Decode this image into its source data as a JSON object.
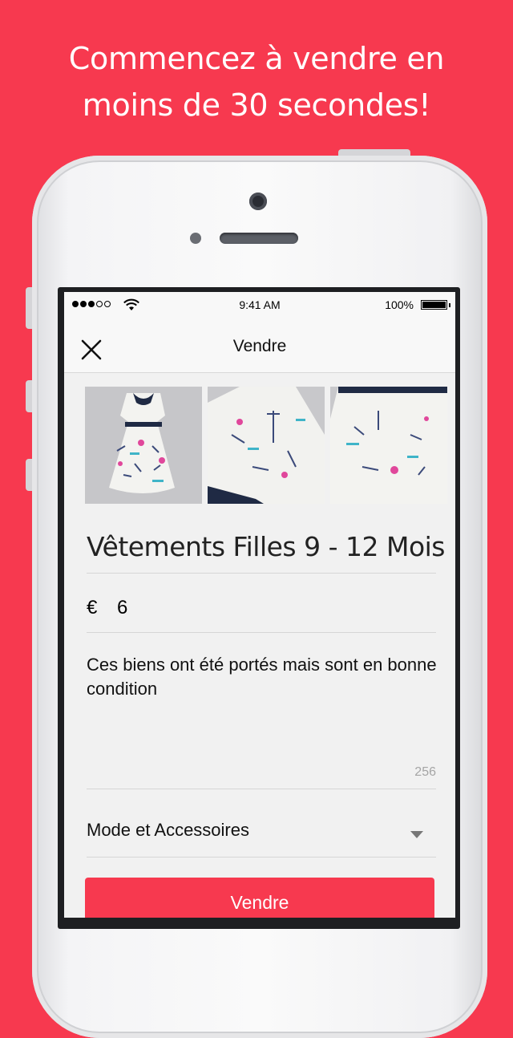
{
  "headline": {
    "line1": "Commencez à vendre en",
    "line2": "moins de 30 secondes!"
  },
  "status_bar": {
    "time": "9:41 AM",
    "battery": "100%"
  },
  "navbar": {
    "title": "Vendre",
    "close_icon": "close-icon"
  },
  "photos": [
    {
      "name": "dress-photo-front"
    },
    {
      "name": "dress-photo-back"
    },
    {
      "name": "dress-photo-detail"
    }
  ],
  "listing": {
    "title": "Vêtements Filles 9 - 12 Mois",
    "currency": "€",
    "price": "6",
    "description": "Ces biens ont été portés mais sont en bonne condition",
    "char_count": "256",
    "category": "Mode et Accessoires"
  },
  "actions": {
    "sell_label": "Vendre"
  },
  "colors": {
    "accent": "#f7394f"
  }
}
